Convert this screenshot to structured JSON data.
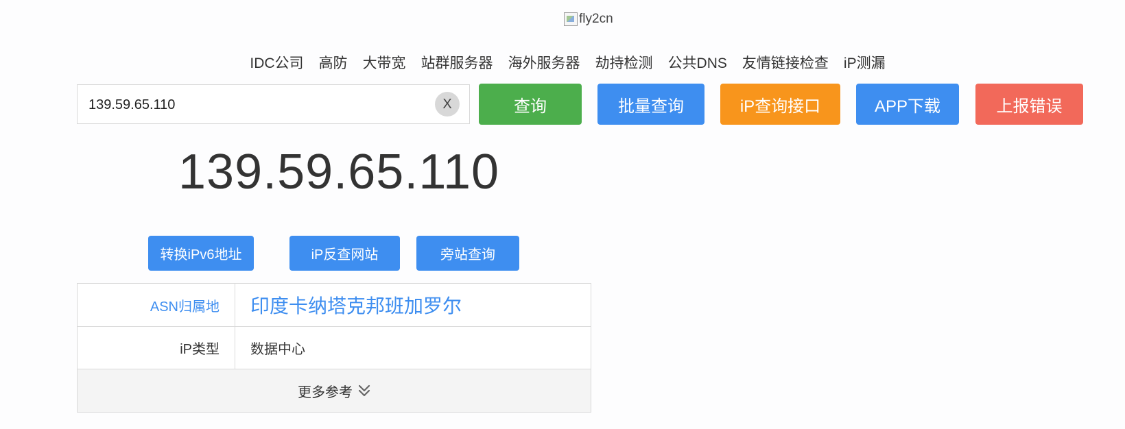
{
  "logo": {
    "alt_text": "fly2cn"
  },
  "nav": {
    "items": [
      "IDC公司",
      "高防",
      "大带宽",
      "站群服务器",
      "海外服务器",
      "劫持检测",
      "公共DNS",
      "友情链接检查",
      "iP测漏"
    ]
  },
  "search": {
    "value": "139.59.65.110",
    "clear_label": "X"
  },
  "buttons": {
    "query": "查询",
    "batch": "批量查询",
    "api": "iP查询接口",
    "app": "APP下载",
    "report": "上报错误"
  },
  "result": {
    "ip": "139.59.65.110",
    "actions": {
      "ipv6": "转换iPv6地址",
      "reverse": "iP反查网站",
      "side": "旁站查询"
    },
    "rows": {
      "asn_label": "ASN归属地",
      "asn_value": "印度卡纳塔克邦班加罗尔",
      "type_label": "iP类型",
      "type_value": "数据中心"
    },
    "more_label": "更多参考"
  },
  "colors": {
    "green": "#4cae4c",
    "blue": "#3e8ef0",
    "orange": "#f8951c",
    "red": "#f2695a"
  }
}
